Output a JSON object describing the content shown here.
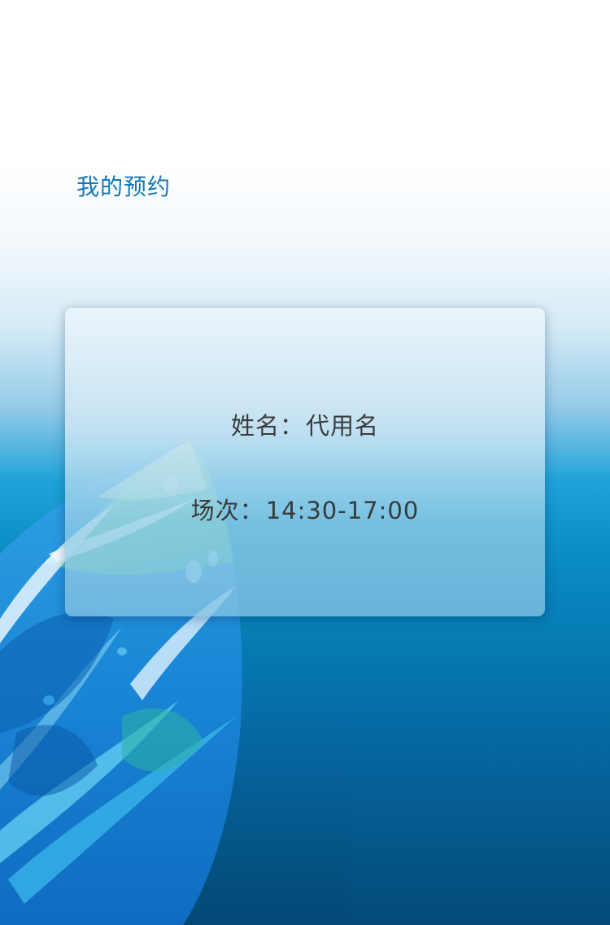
{
  "page": {
    "title": "我的预约"
  },
  "reservation": {
    "name_label": "姓名：",
    "name_value": "代用名",
    "session_label": "场次：",
    "session_value": "14:30-17:00"
  },
  "colors": {
    "title": "#1279b5",
    "text": "#3a3a3a",
    "background_top": "#ffffff",
    "background_bottom": "#034877"
  },
  "decoration": {
    "icon": "abstract-ice-wave-illustration"
  }
}
